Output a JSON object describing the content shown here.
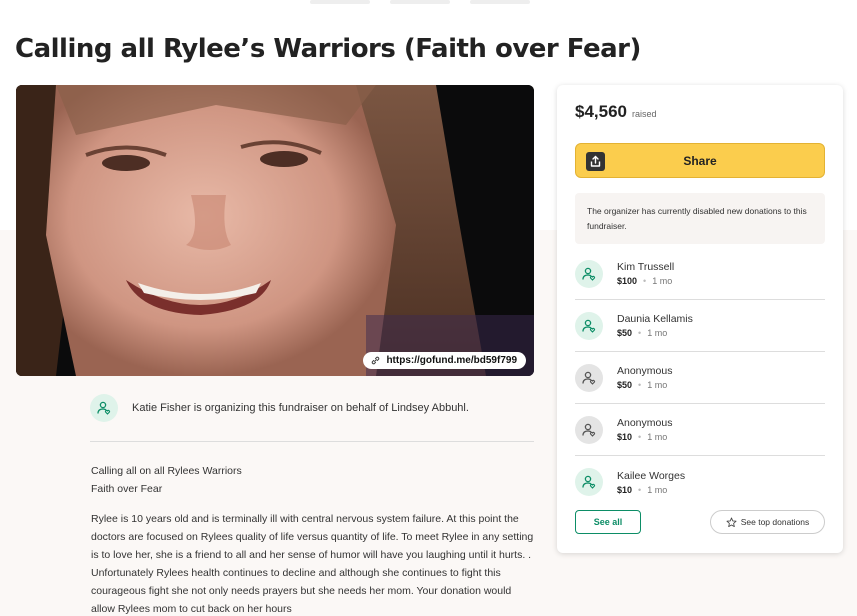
{
  "page": {
    "title": "Calling all Rylee’s Warriors (Faith over Fear)"
  },
  "hero": {
    "url": "https://gofund.me/bd59f799"
  },
  "organizer": {
    "text": "Katie Fisher is organizing this fundraiser on behalf of Lindsey Abbuhl."
  },
  "story": {
    "line1": "Calling all on all Rylees Warriors",
    "line2": "Faith over Fear",
    "body": "Rylee is 10 years old and is terminally ill with central nervous system failure. At this point the doctors are focused on Rylees quality of life versus quantity of life. To meet Rylee in any setting is to love her, she is a friend to all and her sense of humor will have you laughing until it hurts. . Unfortunately Rylees health continues to decline and although she continues to fight this courageous fight she not only needs prayers but she needs her mom. Your donation would allow Rylees mom to cut back on her hours"
  },
  "sidebar": {
    "amount": "$4,560",
    "raised_label": "raised",
    "share_label": "Share",
    "notice": "The organizer has currently disabled new donations to this fundraiser.",
    "donors": [
      {
        "name": "Kim Trussell",
        "amount": "$100",
        "time": "1 mo",
        "avatar": "green"
      },
      {
        "name": "Daunia Kellamis",
        "amount": "$50",
        "time": "1 mo",
        "avatar": "green"
      },
      {
        "name": "Anonymous",
        "amount": "$50",
        "time": "1 mo",
        "avatar": "gray"
      },
      {
        "name": "Anonymous",
        "amount": "$10",
        "time": "1 mo",
        "avatar": "gray"
      },
      {
        "name": "Kailee Worges",
        "amount": "$10",
        "time": "1 mo",
        "avatar": "green"
      }
    ],
    "see_all_label": "See all",
    "see_top_label": "See top donations"
  },
  "colors": {
    "brand_green": "#0c8d66",
    "share_yellow": "#fbcd4d"
  },
  "icons": {
    "share": "share-icon",
    "link": "link-icon",
    "user": "user-heart-icon",
    "star": "star-icon"
  }
}
